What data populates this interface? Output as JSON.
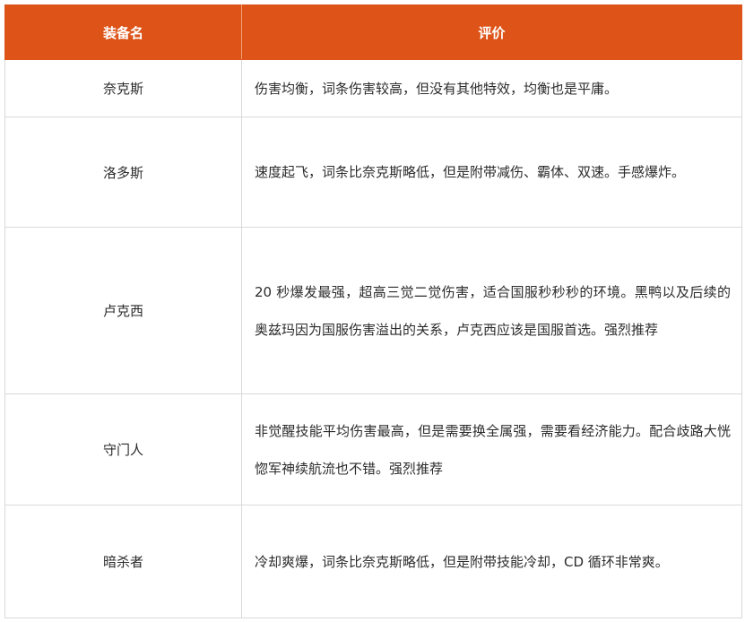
{
  "table": {
    "headers": [
      "装备名",
      "评价"
    ],
    "rows": [
      {
        "name": "奈克斯",
        "review": "伤害均衡，词条伤害较高，但没有其他特效，均衡也是平庸。"
      },
      {
        "name": "洛多斯",
        "review": "速度起飞，词条比奈克斯略低，但是附带减伤、霸体、双速。手感爆炸。"
      },
      {
        "name": "卢克西",
        "review": "20 秒爆发最强，超高三觉二觉伤害，适合国服秒秒秒的环境。黑鸭以及后续的奥兹玛因为国服伤害溢出的关系，卢克西应该是国服首选。强烈推荐"
      },
      {
        "name": "守门人",
        "review": "非觉醒技能平均伤害最高，但是需要换全属强，需要看经济能力。配合歧路大恍惚军神续航流也不错。强烈推荐"
      },
      {
        "name": "暗杀者",
        "review": "冷却爽爆，词条比奈克斯略低，但是附带技能冷却，CD 循环非常爽。"
      }
    ]
  },
  "colors": {
    "header_bg": "#dd5318",
    "header_text": "#ffffff",
    "border": "#d9d9d9",
    "body_text": "#2b2b2b"
  }
}
